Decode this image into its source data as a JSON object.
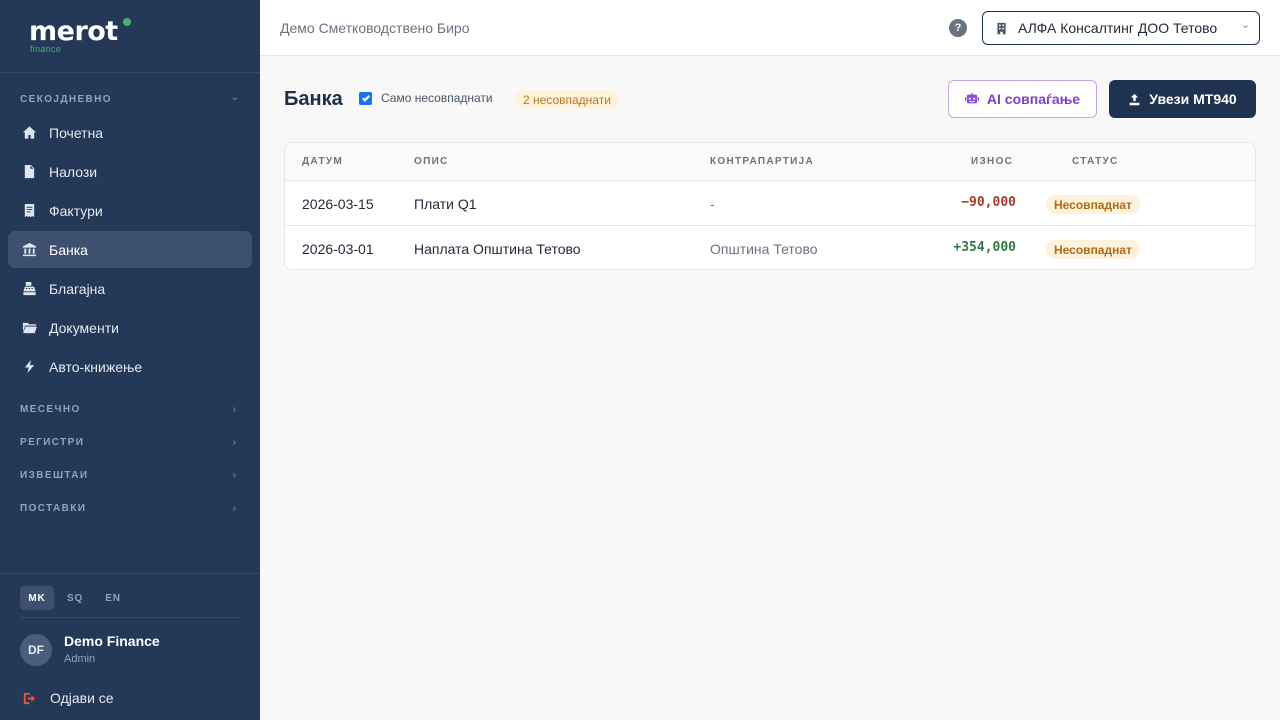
{
  "brand": {
    "name": "merot",
    "sub": "finance",
    "accent": "#4caf6a"
  },
  "sidebar": {
    "sections": {
      "daily": "СЕКОЈДНЕВНО",
      "monthly": "МЕСЕЧНО",
      "registers": "РЕГИСТРИ",
      "reports": "ИЗВЕШТАИ",
      "settings": "ПОСТАВКИ"
    },
    "items": [
      {
        "label": "Почетна",
        "icon": "home-icon"
      },
      {
        "label": "Налози",
        "icon": "document-icon"
      },
      {
        "label": "Фактури",
        "icon": "invoice-icon"
      },
      {
        "label": "Банка",
        "icon": "bank-icon",
        "active": true
      },
      {
        "label": "Благајна",
        "icon": "cash-register-icon"
      },
      {
        "label": "Документи",
        "icon": "folder-icon"
      },
      {
        "label": "Авто-книжење",
        "icon": "bolt-icon"
      }
    ],
    "languages": [
      "MK",
      "SQ",
      "EN"
    ],
    "active_language": "MK",
    "user": {
      "initials": "DF",
      "name": "Demo Finance",
      "role": "Admin"
    },
    "logout": "Одјави се"
  },
  "topbar": {
    "org": "Демо Сметководствено Биро",
    "help": "?",
    "company": "АЛФА Консалтинг ДОО Тетово"
  },
  "main": {
    "title": "Банка",
    "filter_label": "Само несовпаднати",
    "filter_checked": true,
    "unmatched_badge": "2 несовпаднати",
    "ai_button": "AI совпаѓање",
    "import_button": "Увези MT940",
    "table": {
      "headers": {
        "date": "ДАТУМ",
        "description": "ОПИС",
        "counterparty": "КОНТРАПАРТИЈА",
        "amount": "ИЗНОС",
        "status": "СТАТУС"
      },
      "rows": [
        {
          "date": "2026-03-15",
          "description": "Плати Q1",
          "counterparty": "-",
          "amount": "−90,000",
          "status": "Несовпаднат"
        },
        {
          "date": "2026-03-01",
          "description": "Наплата Општина Тетово",
          "counterparty": "Општина Тетово",
          "amount": "+354,000",
          "status": "Несовпаднат"
        }
      ]
    }
  }
}
